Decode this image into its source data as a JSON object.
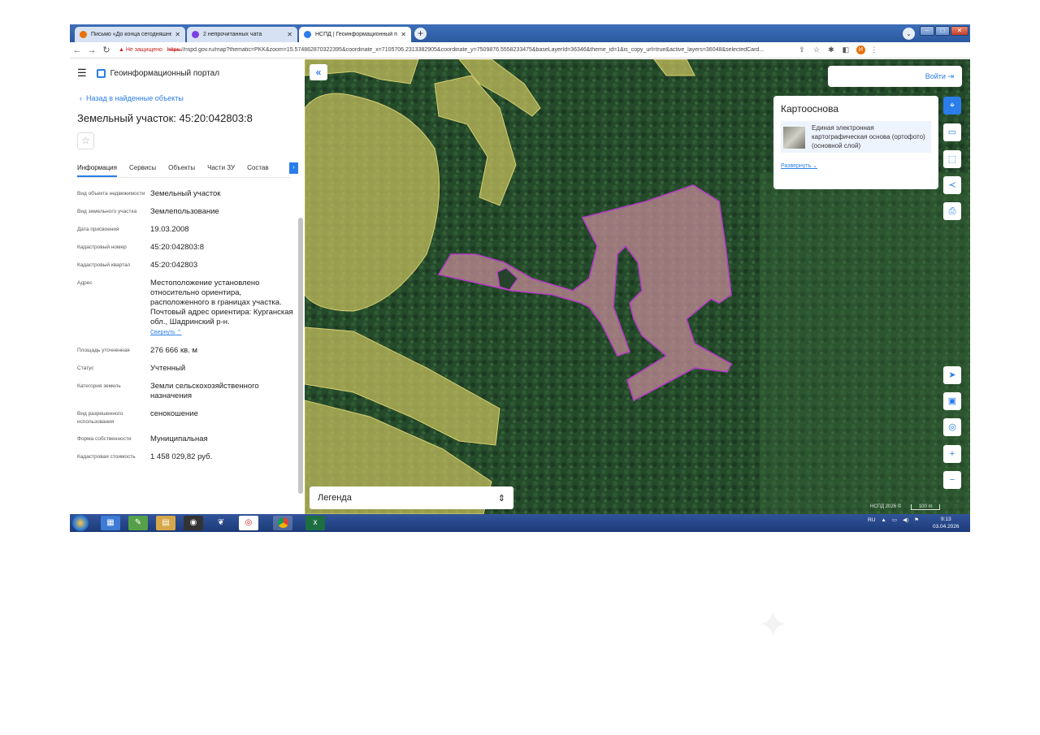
{
  "browser": {
    "tabs": [
      {
        "title": "Письмо «До конца сегодняшнего",
        "favicon_color": "#e8710a",
        "active": false
      },
      {
        "title": "2 непрочитанных чата",
        "favicon_color": "#7b3fe4",
        "active": false
      },
      {
        "title": "НСПД | Геоинформационный п",
        "favicon_color": "#2b7de9",
        "active": true
      }
    ],
    "new_tab_label": "+",
    "insecure_label": "Не защищено",
    "url_scheme": "https:",
    "url_rest": "//nspd.gov.ru/map?thematic=PKK&zoom=15.574862870322395&coordinate_x=7105706.2313382905&coordinate_y=7509876.5558233475&baseLayerId=36346&theme_id=1&is_copy_url=true&active_layers=36048&selectedCard...",
    "profile_initial": "И"
  },
  "panel": {
    "portal_title": "Геоинформационный портал",
    "back_link": "Назад в найденные объекты",
    "title": "Земельный участок: 45:20:042803:8",
    "tabs": [
      "Информация",
      "Сервисы",
      "Объекты",
      "Части ЗУ",
      "Состав"
    ],
    "attributes": [
      {
        "key": "Вид объекта недвижимости",
        "value": "Земельный участок"
      },
      {
        "key": "Вид земельного участка",
        "value": "Землепользование"
      },
      {
        "key": "Дата присвоения",
        "value": "19.03.2008"
      },
      {
        "key": "Кадастровый номер",
        "value": "45:20:042803:8"
      },
      {
        "key": "Кадастровый квартал",
        "value": "45:20:042803"
      },
      {
        "key": "Адрес",
        "value": "Местоположение установлено относительно ориентира, расположенного в границах участка. Почтовый адрес ориентира: Курганская обл., Шадринский р-н."
      },
      {
        "key": "Площадь уточненная",
        "value": "276 666 кв. м"
      },
      {
        "key": "Статус",
        "value": "Учтенный"
      },
      {
        "key": "Категория земель",
        "value": "Земли сельскохозяйственного назначения"
      },
      {
        "key": "Вид разрешенного использования",
        "value": "сенокошение"
      },
      {
        "key": "Форма собственности",
        "value": "Муниципальная"
      },
      {
        "key": "Кадастровая стоимость",
        "value": "1 458 029,82 руб."
      }
    ],
    "collapse_link": "Свернуть"
  },
  "map": {
    "login_label": "Войти",
    "basemap": {
      "title": "Картооснова",
      "layer_name": "Единая электронная картографическая основа (ортофото)(основной слой)",
      "expand_link": "Развернуть"
    },
    "legend_label": "Легенда",
    "attribution": "НСПД 2026 ©",
    "scale_label": "100 m",
    "colors": {
      "forest": "#24432a",
      "field_overlay": "#c8c05e",
      "parcel_fill": "#c98c9a",
      "parcel_stroke": "#b63dc4"
    }
  },
  "taskbar": {
    "language": "RU",
    "time": "9:13",
    "date": "03.04.2026"
  }
}
